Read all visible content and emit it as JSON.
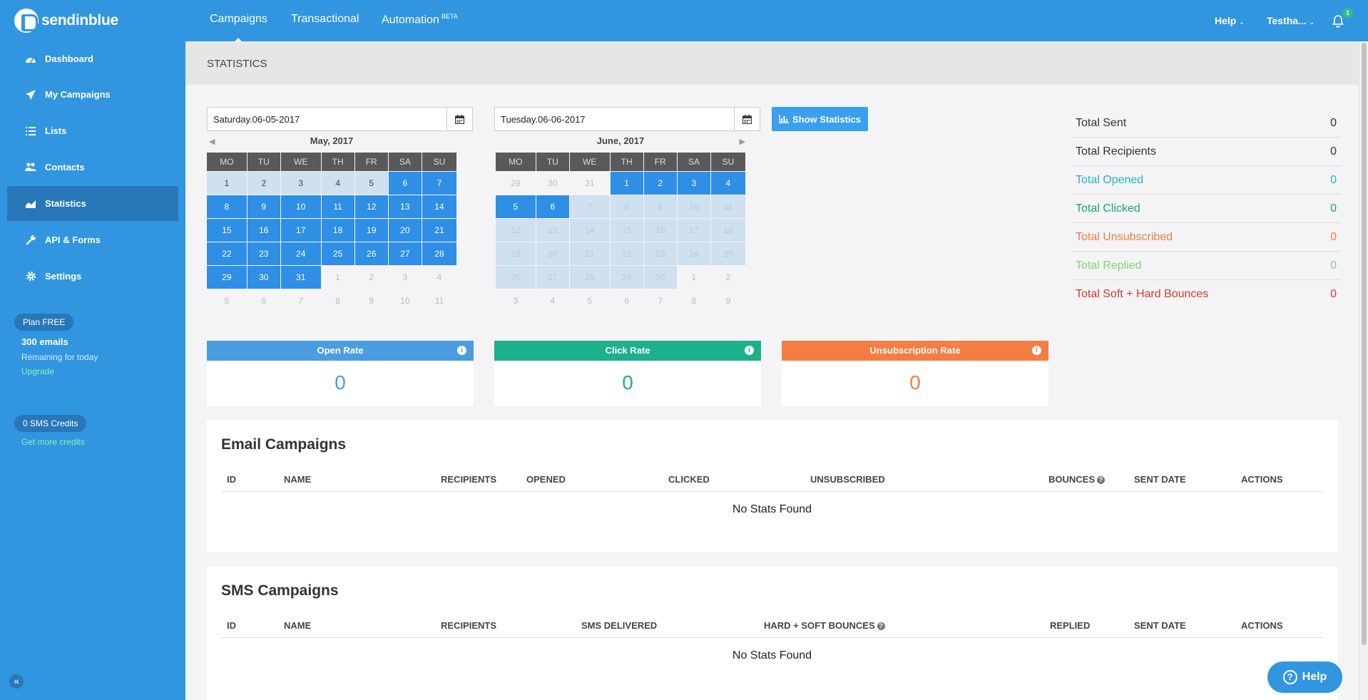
{
  "app": {
    "brand": "sendinblue"
  },
  "topnav": {
    "items": [
      {
        "label": "Campaigns",
        "active": true
      },
      {
        "label": "Transactional"
      },
      {
        "label": "Automation",
        "badge": "BETA"
      }
    ],
    "help_label": "Help",
    "user_label": "Testha...",
    "notification_count": "1"
  },
  "sidebar": {
    "items": [
      {
        "label": "Dashboard",
        "icon": "dashboard-icon"
      },
      {
        "label": "My Campaigns",
        "icon": "paper-plane-icon"
      },
      {
        "label": "Lists",
        "icon": "list-icon"
      },
      {
        "label": "Contacts",
        "icon": "users-icon"
      },
      {
        "label": "Statistics",
        "icon": "area-chart-icon",
        "active": true
      },
      {
        "label": "API & Forms",
        "icon": "wrench-icon"
      },
      {
        "label": "Settings",
        "icon": "gear-icon"
      }
    ],
    "plan": {
      "badge": "Plan FREE",
      "emails": "300 emails",
      "remaining": "Remaining for today",
      "upgrade": "Upgrade"
    },
    "sms": {
      "badge": "0 SMS Credits",
      "link": "Get more credits"
    }
  },
  "page": {
    "title": "STATISTICS"
  },
  "filters": {
    "start_date": "Saturday.06-05-2017",
    "end_date": "Tuesday.06-06-2017",
    "show_button": "Show Statistics"
  },
  "calendars": {
    "weekdays": [
      "MO",
      "TU",
      "WE",
      "TH",
      "FR",
      "SA",
      "SU"
    ],
    "left": {
      "caption": "May, 2017",
      "weeks": [
        [
          "1",
          "2",
          "3",
          "4",
          "5",
          "6",
          "7"
        ],
        [
          "8",
          "9",
          "10",
          "11",
          "12",
          "13",
          "14"
        ],
        [
          "15",
          "16",
          "17",
          "18",
          "19",
          "20",
          "21"
        ],
        [
          "22",
          "23",
          "24",
          "25",
          "26",
          "27",
          "28"
        ],
        [
          "29",
          "30",
          "31",
          "1",
          "2",
          "3",
          "4"
        ],
        [
          "5",
          "6",
          "7",
          "8",
          "9",
          "10",
          "11"
        ]
      ]
    },
    "right": {
      "caption": "June, 2017",
      "weeks": [
        [
          "29",
          "30",
          "31",
          "1",
          "2",
          "3",
          "4"
        ],
        [
          "5",
          "6",
          "7",
          "8",
          "9",
          "10",
          "11"
        ],
        [
          "12",
          "13",
          "14",
          "15",
          "16",
          "17",
          "18"
        ],
        [
          "19",
          "20",
          "21",
          "22",
          "23",
          "24",
          "25"
        ],
        [
          "26",
          "27",
          "28",
          "29",
          "30",
          "1",
          "2"
        ],
        [
          "3",
          "4",
          "5",
          "6",
          "7",
          "8",
          "9"
        ]
      ]
    }
  },
  "totals": [
    {
      "label": "Total Sent",
      "value": "0",
      "color": "#333333"
    },
    {
      "label": "Total Recipients",
      "value": "0",
      "color": "#333333"
    },
    {
      "label": "Total Opened",
      "value": "0",
      "color": "#23b3c9"
    },
    {
      "label": "Total Clicked",
      "value": "0",
      "color": "#1aa57c"
    },
    {
      "label": "Total Unsubscribed",
      "value": "0",
      "color": "#ef7d44"
    },
    {
      "label": "Total Replied",
      "value": "0",
      "color": "#7fd66d"
    },
    {
      "label": "Total Soft + Hard Bounces",
      "value": "0",
      "color": "#d33c2c"
    }
  ],
  "rates": [
    {
      "label": "Open Rate",
      "value": "0",
      "color": "#4a9de0"
    },
    {
      "label": "Click Rate",
      "value": "0",
      "color": "#1db08d"
    },
    {
      "label": "Unsubscription Rate",
      "value": "0",
      "color": "#f47d43"
    }
  ],
  "email_campaigns": {
    "title": "Email Campaigns",
    "columns": [
      "ID",
      "NAME",
      "RECIPIENTS",
      "OPENED",
      "CLICKED",
      "UNSUBSCRIBED",
      "BOUNCES",
      "SENT DATE",
      "ACTIONS"
    ],
    "empty": "No Stats Found"
  },
  "sms_campaigns": {
    "title": "SMS Campaigns",
    "columns": [
      "ID",
      "NAME",
      "RECIPIENTS",
      "SMS DELIVERED",
      "HARD + SOFT BOUNCES",
      "REPLIED",
      "SENT DATE",
      "ACTIONS"
    ],
    "empty": "No Stats Found"
  },
  "help_button": "Help"
}
